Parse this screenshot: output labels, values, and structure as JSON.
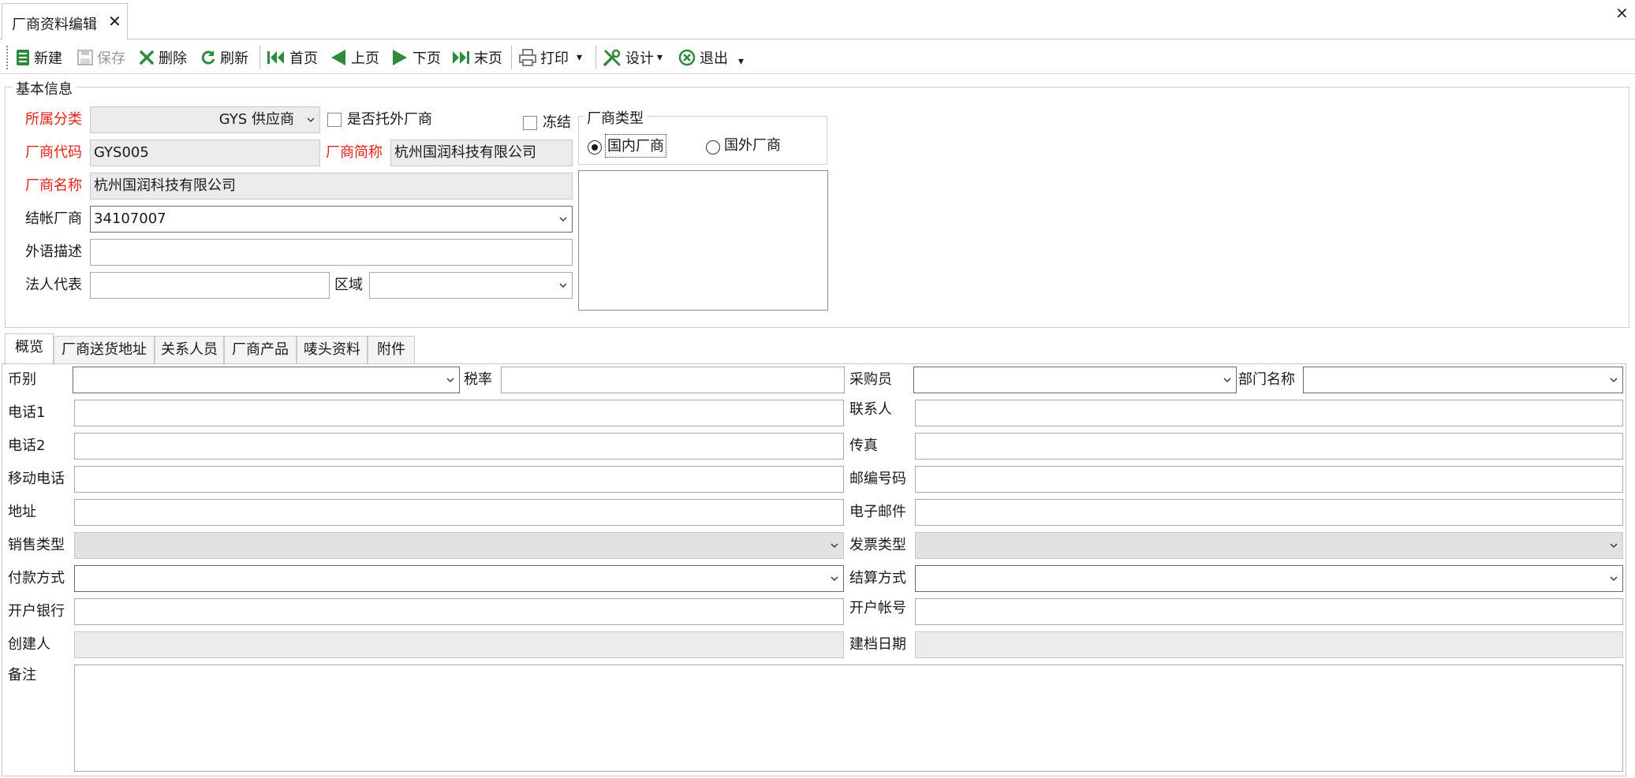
{
  "tab": {
    "title": "厂商资料编辑",
    "close": "✕"
  },
  "window": {
    "close": "×"
  },
  "toolbar": {
    "new": "新建",
    "save": "保存",
    "delete": "删除",
    "refresh": "刷新",
    "first": "首页",
    "prev": "上页",
    "next": "下页",
    "last": "末页",
    "print": "打印",
    "design": "设计",
    "exit": "退出",
    "dropdown_arrow": "▾"
  },
  "basic": {
    "group_title": "基本信息",
    "category_label": "所属分类",
    "category_value": "GYS 供应商",
    "outsourced_label": "是否托外厂商",
    "freeze_label": "冻结",
    "code_label": "厂商代码",
    "code_value": "GYS005",
    "short_label": "厂商简称",
    "short_value": "杭州国润科技有限公司",
    "name_label": "厂商名称",
    "name_value": "杭州国润科技有限公司",
    "settle_label": "结帐厂商",
    "settle_value": "34107007",
    "foreign_label": "外语描述",
    "foreign_value": "",
    "legal_label": "法人代表",
    "legal_value": "",
    "region_label": "区域",
    "region_value": "",
    "vendor_type_title": "厂商类型",
    "domestic_label": "国内厂商",
    "overseas_label": "国外厂商"
  },
  "tabs": [
    "概览",
    "厂商送货地址",
    "关系人员",
    "厂商产品",
    "唛头资料",
    "附件"
  ],
  "overview": {
    "currency_label": "币别",
    "tax_label": "税率",
    "buyer_label": "采购员",
    "dept_label": "部门名称",
    "phone1_label": "电话1",
    "contact_label": "联系人",
    "phone2_label": "电话2",
    "fax_label": "传真",
    "mobile_label": "移动电话",
    "zip_label": "邮编号码",
    "address_label": "地址",
    "email_label": "电子邮件",
    "sales_type_label": "销售类型",
    "invoice_type_label": "发票类型",
    "payment_label": "付款方式",
    "settle_method_label": "结算方式",
    "bank_label": "开户银行",
    "account_label": "开户帐号",
    "creator_label": "创建人",
    "created_label": "建档日期",
    "remark_label": "备注"
  }
}
